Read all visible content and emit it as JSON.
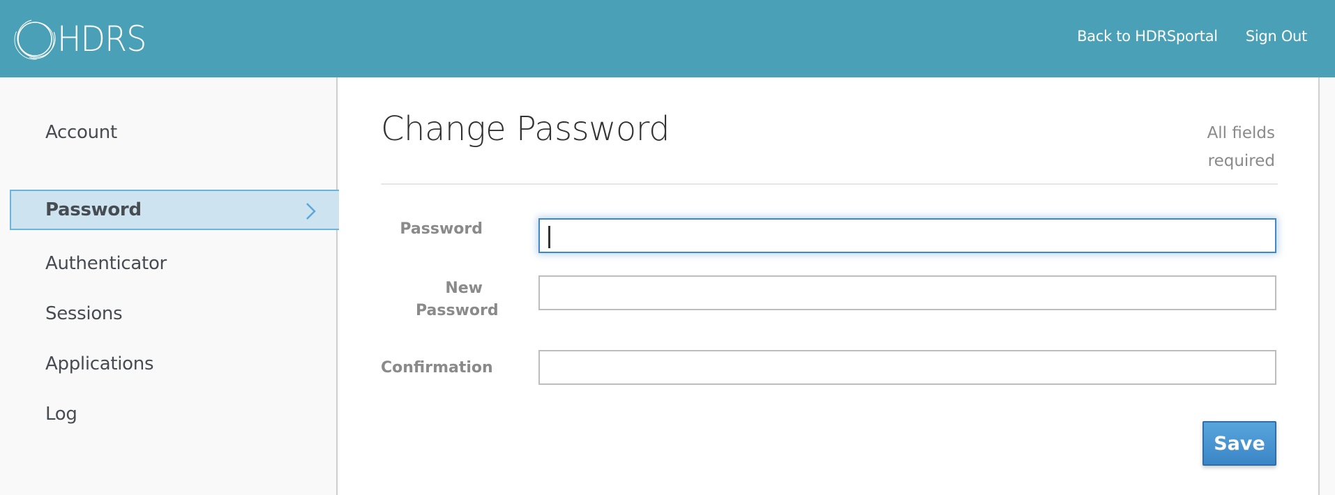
{
  "header": {
    "brand": "HDRS",
    "brand_color": "#4aa0b6",
    "links": [
      {
        "label": "Back to HDRSportal"
      },
      {
        "label": "Sign Out"
      }
    ]
  },
  "sidebar": {
    "items": [
      {
        "label": "Account",
        "active": false
      },
      {
        "label": "Password",
        "active": true
      },
      {
        "label": "Authenticator",
        "active": false
      },
      {
        "label": "Sessions",
        "active": false
      },
      {
        "label": "Applications",
        "active": false
      },
      {
        "label": "Log",
        "active": false
      }
    ]
  },
  "main": {
    "title": "Change Password",
    "required_note": "All fields required",
    "fields": [
      {
        "label": "Password",
        "value": "",
        "placeholder": "",
        "focused": true
      },
      {
        "label": "New Password",
        "value": "",
        "placeholder": ""
      },
      {
        "label": "Confirmation",
        "value": "",
        "placeholder": ""
      }
    ],
    "save_label": "Save",
    "accent_color": "#3b85c6"
  }
}
